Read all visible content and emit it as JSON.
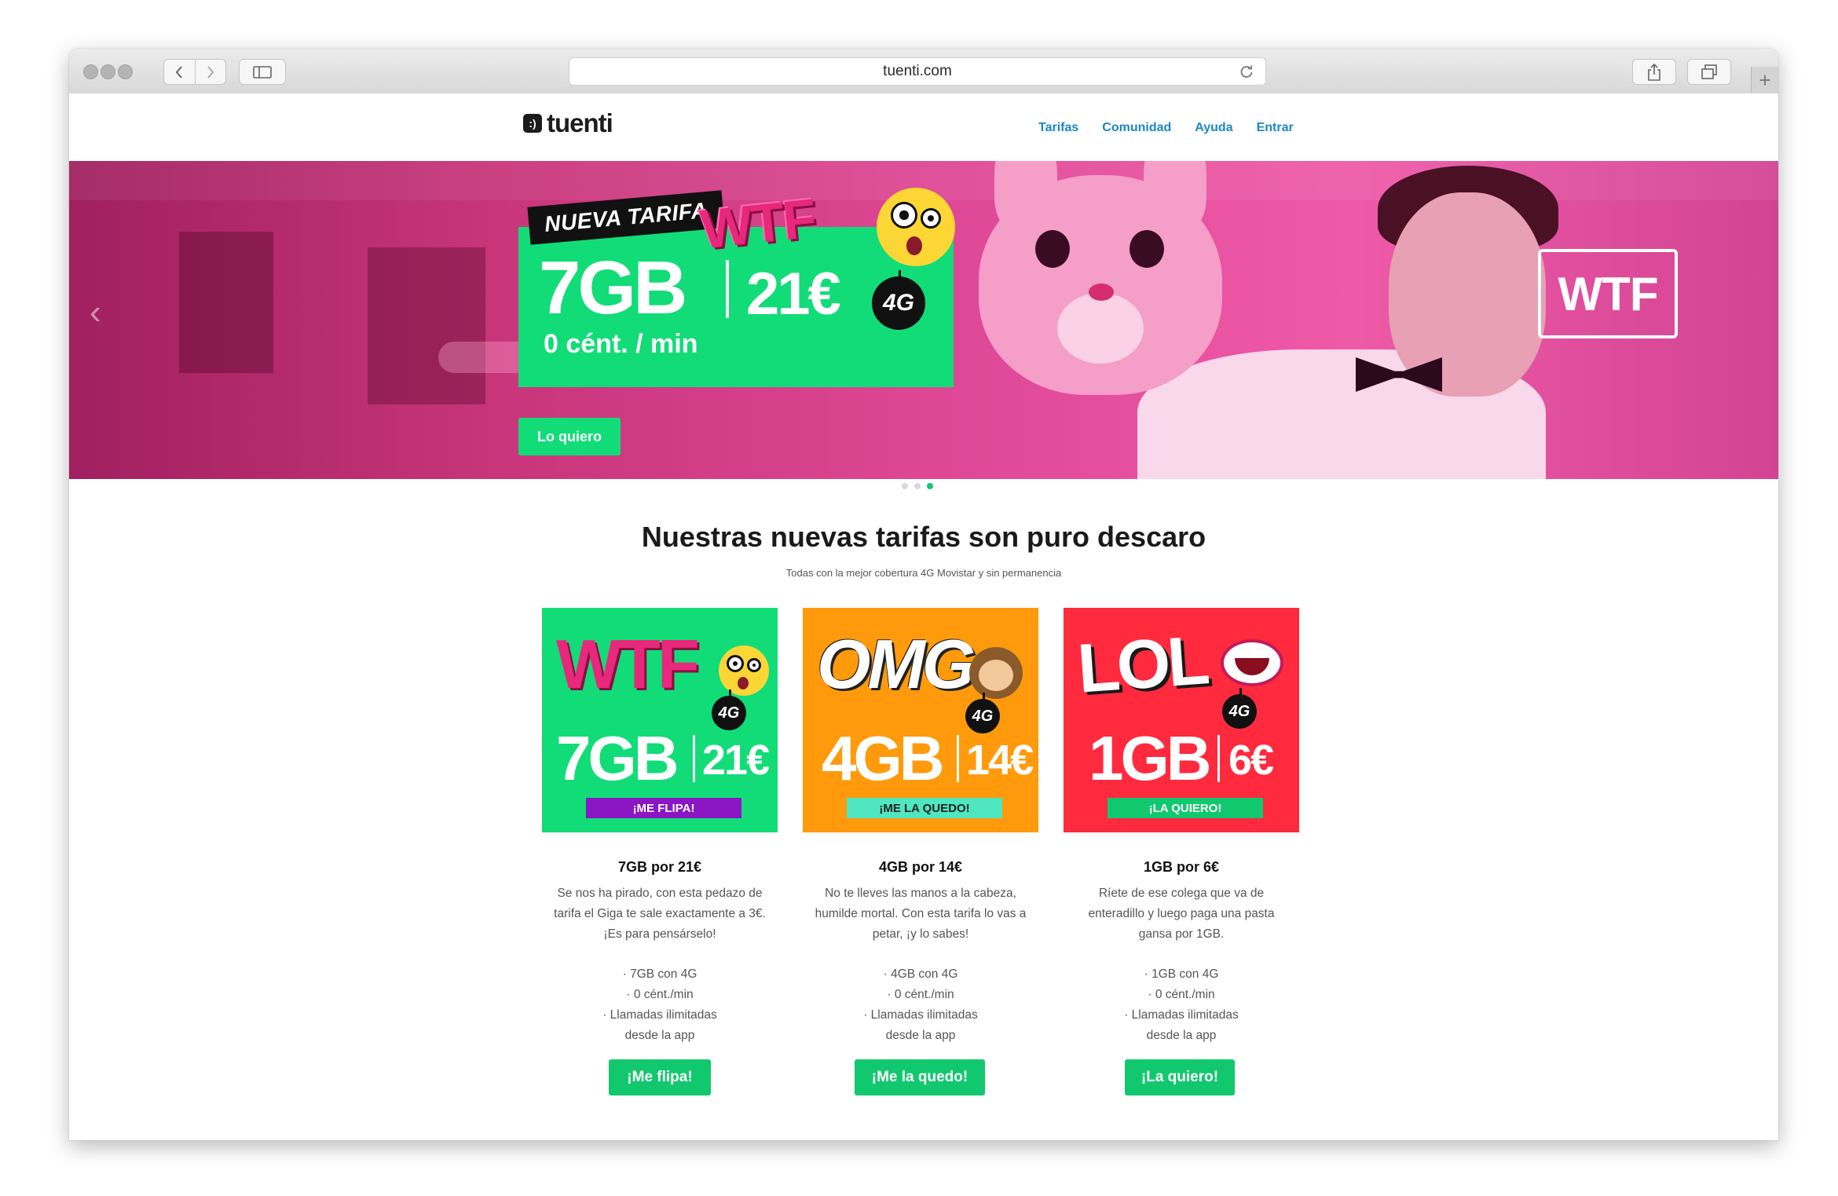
{
  "browser": {
    "url": "tuenti.com"
  },
  "site": {
    "logo_mark": ":)",
    "logo_text": "tuenti",
    "nav": [
      "Tarifas",
      "Comunidad",
      "Ayuda",
      "Entrar"
    ]
  },
  "hero": {
    "badge": "NUEVA TARIFA",
    "word": "WTF",
    "data_amount": "7GB",
    "price": "21€",
    "network": "4G",
    "calls": "0 cént. / min",
    "cta": "Lo quiero",
    "bubble_text": "WTF",
    "slides_total": 3,
    "slide_active": 3
  },
  "section": {
    "title": "Nuestras nuevas tarifas son puro descaro",
    "subtitle": "Todas con la mejor cobertura 4G Movistar y sin permanencia"
  },
  "plans": [
    {
      "word": "WTF",
      "network": "4G",
      "gb": "7GB",
      "price": "21€",
      "ribbon": "¡ME FLIPA!",
      "heading": "7GB por 21€",
      "description": "Se nos ha pirado, con esta pedazo de\ntarifa el Giga te sale exactamente a 3€.\n¡Es para pensárselo!",
      "features": [
        "· 7GB con 4G",
        "· 0 cént./min",
        "· Llamadas ilimitadas\ndesde la app"
      ],
      "button": "¡Me flipa!",
      "bg_color": "#12dc78",
      "ribbon_color": "#8a16c4"
    },
    {
      "word": "OMG",
      "network": "4G",
      "gb": "4GB",
      "price": "14€",
      "ribbon": "¡ME LA QUEDO!",
      "heading": "4GB por 14€",
      "description": "No te lleves las manos a la cabeza,\nhumilde mortal. Con esta tarifa lo vas a\npetar, ¡y lo sabes!",
      "features": [
        "· 4GB con 4G",
        "· 0 cént./min",
        "· Llamadas ilimitadas\ndesde la app"
      ],
      "button": "¡Me la quedo!",
      "bg_color": "#ff9a0c",
      "ribbon_color": "#4fe6c0"
    },
    {
      "word": "LOL",
      "network": "4G",
      "gb": "1GB",
      "price": "6€",
      "ribbon": "¡LA QUIERO!",
      "heading": "1GB por 6€",
      "description": "Ríete de ese colega que va de\nenteradillo y luego paga una pasta\ngansa por 1GB.",
      "features": [
        "· 1GB con 4G",
        "· 0 cént./min",
        "· Llamadas ilimitadas\ndesde la app"
      ],
      "button": "¡La quiero!",
      "bg_color": "#ff2a3e",
      "ribbon_color": "#12c86f"
    }
  ]
}
